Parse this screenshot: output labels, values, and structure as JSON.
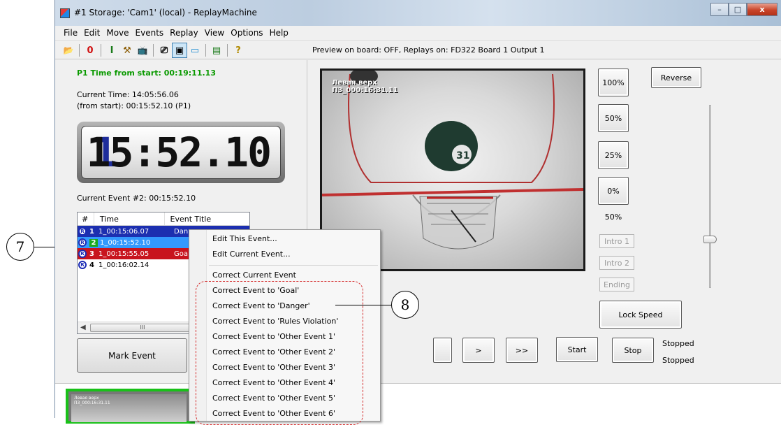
{
  "window": {
    "title": "#1 Storage: 'Cam1' (local) - ReplayMachine",
    "controls": {
      "minimize": "–",
      "maximize": "□",
      "close": "x"
    }
  },
  "menu": [
    "File",
    "Edit",
    "Move",
    "Events",
    "Replay",
    "View",
    "Options",
    "Help"
  ],
  "toolbar": {
    "items": [
      {
        "icon": "open-folder-icon",
        "glyph": "📂"
      },
      {
        "icon": "zero-icon",
        "glyph": "0"
      },
      {
        "icon": "marker-i-icon",
        "glyph": "I"
      },
      {
        "icon": "tools-icon",
        "glyph": "⚒"
      },
      {
        "icon": "tv-icon",
        "glyph": "📺"
      },
      {
        "icon": "output-icon",
        "glyph": "⎚"
      },
      {
        "icon": "monitor-icon",
        "glyph": "▣"
      },
      {
        "icon": "screen-icon",
        "glyph": "▭"
      },
      {
        "icon": "export-icon",
        "glyph": "▤"
      },
      {
        "icon": "help-icon",
        "glyph": "?"
      }
    ],
    "preview_info": "Preview on board: OFF, Replays on: FD322 Board 1 Output 1"
  },
  "left": {
    "p1_time": "P1 Time from start: 00:19:11.13",
    "current_time": "Current Time: 14:05:56.06",
    "from_start": "(from start): 00:15:52.10 (P1)",
    "lcd": {
      "field": "1",
      "time": "15:52.10"
    },
    "current_event": "Current Event #2: 00:15:52.10",
    "list_headers": {
      "num": "#",
      "time": "Time",
      "title": "Event Title"
    },
    "events": [
      {
        "num": "1",
        "time": "1_00:15:06.07",
        "title": "Dan"
      },
      {
        "num": "2",
        "time": "1_00:15:52.10",
        "title": ""
      },
      {
        "num": "3",
        "time": "1_00:15:55.05",
        "title": "Goa"
      },
      {
        "num": "4",
        "time": "1_00:16:02.14",
        "title": ""
      }
    ],
    "scroll_thumb": "III",
    "mark_event": "Mark Event"
  },
  "video": {
    "overlay_line1": "Левая верх",
    "overlay_line2": "П3_000:16:31.11"
  },
  "speed": {
    "reverse": "Reverse",
    "p100": "100%",
    "p50": "50%",
    "p25": "25%",
    "p0": "0%",
    "current_pct": "50%",
    "intro1": "Intro 1",
    "intro2": "Intro 2",
    "ending": "Ending",
    "lock_speed": "Lock Speed",
    "slider_value": 0.5
  },
  "playback": {
    "fwd": ">",
    "ffwd": ">>",
    "start": "Start",
    "stop": "Stop",
    "status1": "Stopped",
    "status2": "Stopped"
  },
  "context_menu": {
    "edit_this": "Edit This Event...",
    "edit_current": "Edit Current Event...",
    "correct_current": "Correct Current Event",
    "items": [
      "Correct Event to 'Goal'",
      "Correct Event to 'Danger'",
      "Correct Event to 'Rules Violation'",
      "Correct Event to 'Other Event 1'",
      "Correct Event to 'Other Event 2'",
      "Correct Event to 'Other Event 3'",
      "Correct Event to 'Other Event 4'",
      "Correct Event to 'Other Event 5'",
      "Correct Event to 'Other Event 6'"
    ]
  },
  "thumbnail": {
    "line1": "Левая верх",
    "line2": "П3_000:16:31.11"
  },
  "callouts": {
    "seven": "7",
    "eight": "8"
  },
  "colors": {
    "p1_green": "#0a9a00",
    "row_blue": "#1c2fb0",
    "row_selected": "#3399ff",
    "row_red": "#c8141e",
    "lcd_field": "#1e2d9b",
    "thumb_border": "#19c119",
    "dash": "#d42a2a"
  }
}
